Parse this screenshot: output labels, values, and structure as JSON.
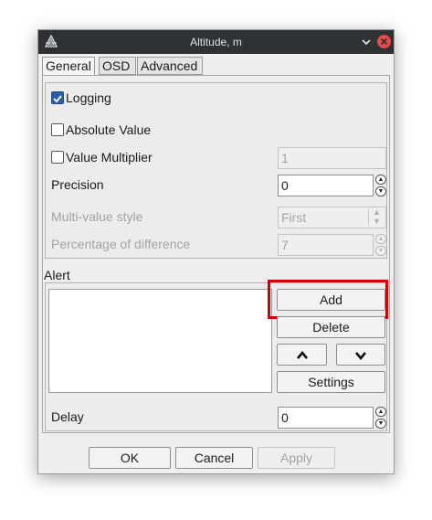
{
  "window": {
    "title": "Altitude, m"
  },
  "tabs": [
    {
      "label": "General",
      "active": true
    },
    {
      "label": "OSD",
      "active": false
    },
    {
      "label": "Advanced",
      "active": false
    }
  ],
  "general": {
    "logging": {
      "label": "Logging",
      "checked": true
    },
    "absolute_value": {
      "label": "Absolute Value",
      "checked": false
    },
    "value_multiplier": {
      "label": "Value Multiplier",
      "checked": false,
      "value": "1"
    },
    "precision": {
      "label": "Precision",
      "value": "0"
    },
    "multi_value_style": {
      "label": "Multi-value style",
      "value": "First"
    },
    "percentage_difference": {
      "label": "Percentage of difference",
      "value": "7"
    }
  },
  "alert": {
    "label": "Alert",
    "buttons": {
      "add": "Add",
      "delete": "Delete",
      "settings": "Settings"
    },
    "delay": {
      "label": "Delay",
      "value": "0"
    }
  },
  "footer": {
    "ok": "OK",
    "cancel": "Cancel",
    "apply": "Apply"
  },
  "colors": {
    "titlebar": "#2f3235",
    "close": "#e84a4a",
    "highlight": "#d40000",
    "checked": "#2b5fa8"
  },
  "icons": {
    "app": "app-logo-icon",
    "minimize": "chevron-down-icon",
    "close": "close-icon",
    "up": "chevron-up-icon",
    "down": "chevron-down-icon"
  }
}
